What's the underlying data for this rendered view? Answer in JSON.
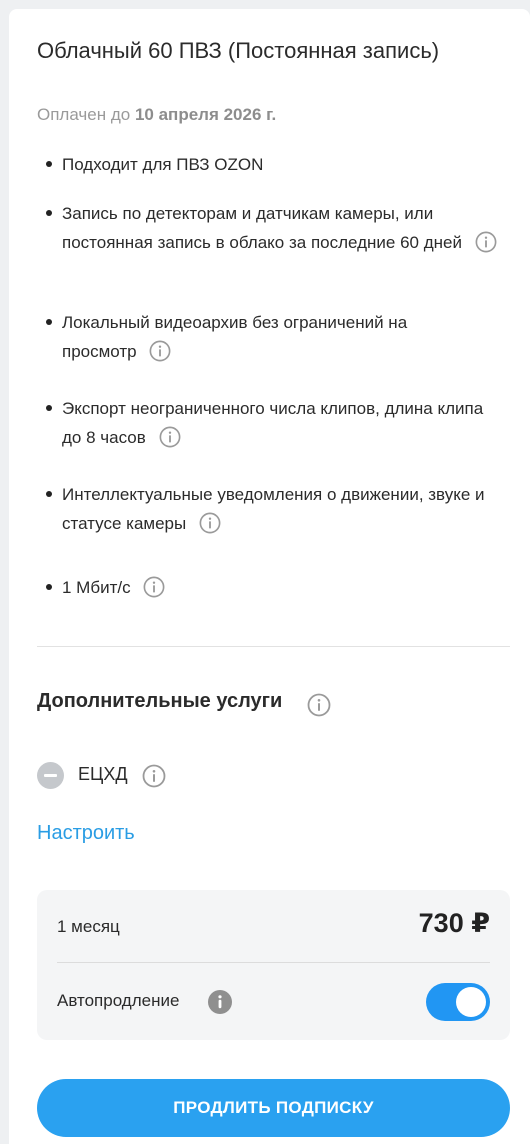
{
  "plan": {
    "title": "Облачный 60 ПВЗ (Постоянная запись)",
    "paid_prefix": "Оплачен до",
    "paid_date": "10 апреля 2026 г."
  },
  "features": [
    "Подходит для ПВЗ OZON",
    "Запись по детекторам и датчикам камеры, или постоянная запись в облако за последние 60 дней",
    "Локальный видеоархив без ограничений на просмотр",
    "Экспорт неограниченного числа клипов, длина клипа до 8 часов",
    "Интеллектуальные уведомления о движении, звуке и статусе камеры",
    "1 Мбит/с"
  ],
  "extra": {
    "title": "Дополнительные услуги",
    "service_label": "ЕЦХД",
    "configure_label": "Настроить"
  },
  "pricing": {
    "period": "1 месяц",
    "price": "730 ₽",
    "autorenew_label": "Автопродление",
    "autorenew_on": true
  },
  "actions": {
    "renew_label": "ПРОДЛИТЬ ПОДПИСКУ"
  },
  "colors": {
    "accent": "#2aa1f0",
    "link": "#2a9de4",
    "toggle_on": "#2196f3"
  }
}
